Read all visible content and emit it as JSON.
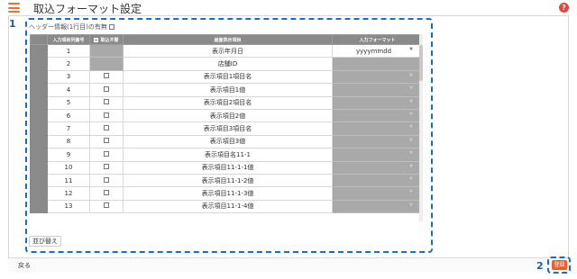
{
  "header": {
    "title": "取込フォーマット設定",
    "help_label": "?"
  },
  "annotations": {
    "box1": "1",
    "box2": "2"
  },
  "options": {
    "header_info_label": "ヘッダー情報(1行目)の有無"
  },
  "table": {
    "columns": [
      "入力項目列番号",
      "取込不要",
      "画面表示項目",
      "入力フォーマット"
    ],
    "rows": [
      {
        "num": "1",
        "item": "表示年月日",
        "format": "yyyymmdd"
      },
      {
        "num": "2",
        "item": "店舗ID",
        "format": ""
      },
      {
        "num": "3",
        "item": "表示項目1項目名",
        "format": ""
      },
      {
        "num": "4",
        "item": "表示項目1値",
        "format": ""
      },
      {
        "num": "5",
        "item": "表示項目2項目名",
        "format": ""
      },
      {
        "num": "6",
        "item": "表示項目2値",
        "format": ""
      },
      {
        "num": "7",
        "item": "表示項目3項目名",
        "format": ""
      },
      {
        "num": "8",
        "item": "表示項目3値",
        "format": ""
      },
      {
        "num": "9",
        "item": "表示項目名11-1",
        "format": ""
      },
      {
        "num": "10",
        "item": "表示項目11-1-1値",
        "format": ""
      },
      {
        "num": "11",
        "item": "表示項目11-1-2値",
        "format": ""
      },
      {
        "num": "12",
        "item": "表示項目11-1-3値",
        "format": ""
      },
      {
        "num": "13",
        "item": "表示項目11-1-4値",
        "format": ""
      }
    ]
  },
  "buttons": {
    "sort_label": "並び替え",
    "back_label": "戻る",
    "register_label": "登録"
  },
  "colors": {
    "accent": "#e8742c",
    "annotation": "#1a6cc7",
    "header_gray": "#8a8a8a"
  }
}
